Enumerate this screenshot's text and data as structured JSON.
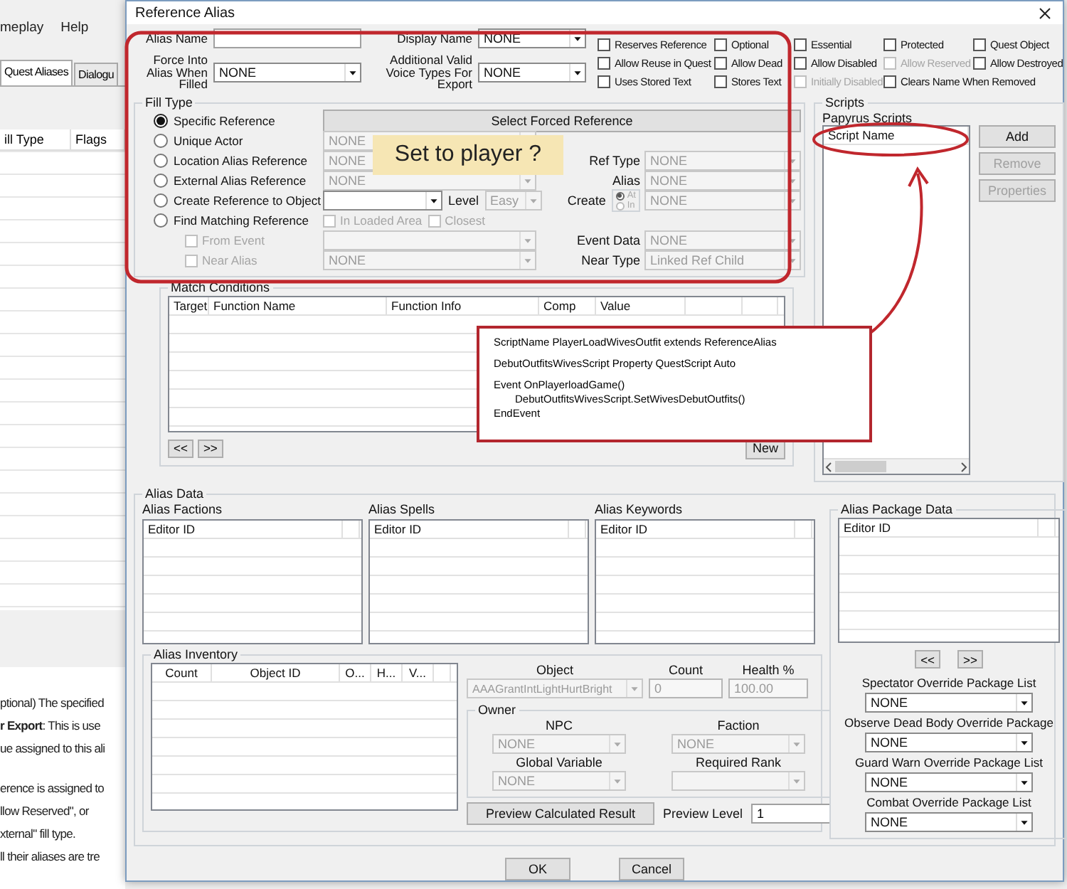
{
  "background_window": {
    "menu": [
      "meplay",
      "Help"
    ],
    "tabs": [
      {
        "label": "Quest Aliases",
        "selected": true
      },
      {
        "label": "Dialogu",
        "selected": false
      }
    ],
    "columns": [
      "ill Type",
      "Flags"
    ],
    "doc_paragraphs": [
      [
        "ptional) The specified",
        "**r Export**: This is use",
        "ue assigned to this ali"
      ],
      [
        "erence is assigned to",
        "llow Reserved\", or",
        "xternal\" fill type.",
        "ll their aliases are tre"
      ]
    ]
  },
  "dialog": {
    "title": "Reference Alias",
    "alias_name": {
      "label": "Alias Name"
    },
    "display_name": {
      "label": "Display Name",
      "value": "NONE"
    },
    "force_into_alias": {
      "label": "Force Into Alias When Filled",
      "value": "NONE"
    },
    "voice_types": {
      "label": "Additional Valid Voice Types For Export",
      "value": "NONE"
    },
    "flags": [
      {
        "label": "Reserves Reference",
        "checked": false,
        "disabled": false
      },
      {
        "label": "Optional",
        "checked": false,
        "disabled": false
      },
      {
        "label": "Essential",
        "checked": false,
        "disabled": false
      },
      {
        "label": "Protected",
        "checked": false,
        "disabled": false
      },
      {
        "label": "Quest Object",
        "checked": false,
        "disabled": false
      },
      {
        "label": "Allow Reuse in Quest",
        "checked": false,
        "disabled": false
      },
      {
        "label": "Allow Dead",
        "checked": false,
        "disabled": false
      },
      {
        "label": "Allow Disabled",
        "checked": false,
        "disabled": false
      },
      {
        "label": "Allow Reserved",
        "checked": false,
        "disabled": true
      },
      {
        "label": "Allow Destroyed",
        "checked": false,
        "disabled": false
      },
      {
        "label": "Uses Stored Text",
        "checked": false,
        "disabled": false
      },
      {
        "label": "Stores Text",
        "checked": false,
        "disabled": false
      },
      {
        "label": "Initially Disabled",
        "checked": false,
        "disabled": true
      },
      {
        "label": "Clears Name When Removed",
        "checked": false,
        "disabled": false
      }
    ],
    "fill_type": {
      "title": "Fill Type",
      "rows": [
        {
          "kind": "radio",
          "label": "Specific Reference",
          "selected": true,
          "control": {
            "kind": "button",
            "label": "Select Forced Reference"
          }
        },
        {
          "kind": "radio",
          "label": "Unique Actor",
          "selected": false,
          "control": {
            "kind": "select",
            "value": "NONE",
            "disabled": true
          }
        },
        {
          "kind": "radio",
          "label": "Location Alias Reference",
          "selected": false,
          "control": {
            "kind": "select",
            "value": "NONE",
            "disabled": true
          },
          "side": {
            "label": "Ref Type",
            "value": "NONE",
            "disabled": true
          }
        },
        {
          "kind": "radio",
          "label": "External Alias Reference",
          "selected": false,
          "control": {
            "kind": "select",
            "value": "NONE",
            "disabled": true
          },
          "side": {
            "label": "Alias",
            "value": "NONE",
            "disabled": true
          }
        },
        {
          "kind": "radio",
          "label": "Create Reference to Object",
          "selected": false,
          "control": {
            "kind": "select",
            "disabled": false
          },
          "level": {
            "label": "Level",
            "value": "Easy",
            "disabled": true
          },
          "side": {
            "label": "Create",
            "value": "NONE",
            "disabled": true,
            "options": [
              {
                "label": "At",
                "selected": true
              },
              {
                "label": "In",
                "selected": false
              }
            ]
          }
        },
        {
          "kind": "radio",
          "label": "Find Matching Reference",
          "selected": false,
          "checks": [
            {
              "label": "In Loaded Area",
              "checked": false,
              "disabled": true
            },
            {
              "label": "Closest",
              "checked": false,
              "disabled": true
            }
          ]
        },
        {
          "kind": "check",
          "label": "From Event",
          "checked": false,
          "disabled": true,
          "control": {
            "kind": "select",
            "disabled": true
          },
          "side": {
            "label": "Event Data",
            "value": "NONE",
            "disabled": true
          }
        },
        {
          "kind": "check",
          "label": "Near Alias",
          "checked": false,
          "disabled": true,
          "control": {
            "kind": "select",
            "value": "NONE",
            "disabled": true
          },
          "side": {
            "label": "Near Type",
            "value": "Linked Ref Child",
            "disabled": true
          }
        }
      ]
    },
    "note": {
      "text": "Set to player ?"
    },
    "match_conditions": {
      "title": "Match Conditions",
      "columns": [
        "Target",
        "Function Name",
        "Function Info",
        "Comp",
        "Value"
      ],
      "nav": [
        "<<",
        ">>"
      ],
      "new_button": "New"
    },
    "scripts": {
      "title": "Scripts",
      "list_title": "Papyrus Scripts",
      "column": "Script Name",
      "buttons": [
        {
          "label": "Add",
          "disabled": false
        },
        {
          "label": "Remove",
          "disabled": true
        },
        {
          "label": "Properties",
          "disabled": true
        }
      ]
    },
    "code_note": {
      "blocks": [
        [
          {
            "text": "ScriptName PlayerLoadWivesOutfit extends ReferenceAlias",
            "kind": "plain"
          }
        ],
        [
          {
            "text": "DebutOutfitsWivesScript Property QuestScript Auto",
            "kind": "plain"
          }
        ],
        [
          {
            "text": "Event OnPlayerloadGame()",
            "kind": "plain"
          },
          {
            "text": "DebutOutfitsWivesScript.SetWivesDebutOutfits()",
            "kind": "indented"
          },
          {
            "text": "EndEvent",
            "kind": "plain"
          }
        ]
      ]
    },
    "alias_data": {
      "title": "Alias Data",
      "lists": [
        {
          "title": "Alias Factions",
          "column": "Editor ID"
        },
        {
          "title": "Alias Spells",
          "column": "Editor ID"
        },
        {
          "title": "Alias Keywords",
          "column": "Editor ID"
        }
      ],
      "inventory": {
        "title": "Alias Inventory",
        "columns": [
          "Count",
          "Object ID",
          "O...",
          "H...",
          "V..."
        ],
        "object": {
          "label": "Object",
          "value": "AAAGrantIntLightHurtBright",
          "disabled": true
        },
        "count": {
          "label": "Count",
          "value": "0",
          "disabled": true
        },
        "health": {
          "label": "Health %",
          "value": "100.00",
          "disabled": true
        },
        "owner": {
          "title": "Owner",
          "fields": [
            {
              "label": "NPC",
              "value": "NONE",
              "disabled": true
            },
            {
              "label": "Faction",
              "value": "NONE",
              "disabled": true
            },
            {
              "label": "Global Variable",
              "value": "NONE",
              "disabled": true
            },
            {
              "label": "Required Rank",
              "disabled": true
            }
          ]
        },
        "preview_button": "Preview Calculated Result",
        "preview_level": {
          "label": "Preview Level",
          "value": "1"
        }
      },
      "package_data": {
        "title": "Alias Package Data",
        "column": "Editor ID",
        "nav": [
          "<<",
          ">>"
        ],
        "overrides": [
          {
            "label": "Spectator Override Package List",
            "value": "NONE",
            "disabled": false
          },
          {
            "label": "Observe Dead Body Override Package",
            "value": "NONE",
            "disabled": false
          },
          {
            "label": "Guard Warn Override Package List",
            "value": "NONE",
            "disabled": false
          },
          {
            "label": "Combat Override Package List",
            "value": "NONE",
            "disabled": false
          }
        ]
      }
    },
    "buttons": [
      "OK",
      "Cancel"
    ]
  }
}
